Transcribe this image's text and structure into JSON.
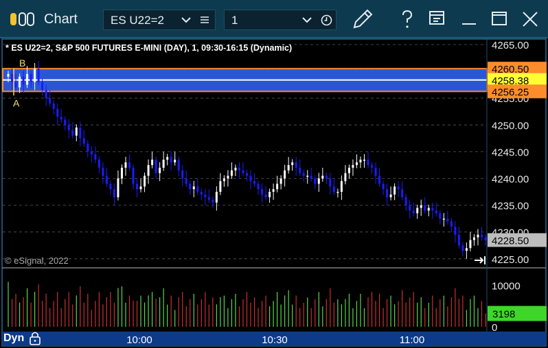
{
  "app": {
    "title": "Chart"
  },
  "toolbar": {
    "symbol": "ES U22=2",
    "interval": "1",
    "icons": [
      "app-logo-icon",
      "chevron-down-icon",
      "list-icon",
      "chevron-down-icon",
      "clock-icon",
      "pencil-icon",
      "help-icon",
      "layout-icon",
      "minimize-icon",
      "maximize-icon",
      "close-icon"
    ]
  },
  "chart_title": "* ES U22=2, S&P 500 FUTURES E-MINI (DAY), 1, 09:30-16:15 (Dynamic)",
  "copyright": "© eSignal, 2022",
  "footer": {
    "mode": "Dyn"
  },
  "colors": {
    "up": "#ffffff",
    "down": "#1b1bff",
    "band": "#2e5de8",
    "band_border": "#ff8c2a",
    "volume_up": "#5bd94d",
    "volume_down": "#cc2f2f",
    "title_bar": "#0e3a4f"
  },
  "chart_data": {
    "type": "candlestick",
    "title": "* ES U22=2, S&P 500 FUTURES E-MINI (DAY), 1, 09:30-16:15 (Dynamic)",
    "price_axis": {
      "ylim": [
        4224,
        4266
      ],
      "ticks": [
        "4265.00",
        "4260.00",
        "4255.00",
        "4250.00",
        "4245.00",
        "4240.00",
        "4235.00",
        "4230.00",
        "4225.00"
      ]
    },
    "price_labels": [
      {
        "value": 4260.5,
        "text": "4260.50",
        "bg": "#ff8c2a",
        "fg": "#000000"
      },
      {
        "value": 4258.38,
        "text": "4258.38",
        "bg": "#ffff33",
        "fg": "#000000"
      },
      {
        "value": 4256.25,
        "text": "4256.25",
        "bg": "#ff8c2a",
        "fg": "#000000"
      },
      {
        "value": 4228.5,
        "text": "4228.50",
        "bg": "#bdbdbd",
        "fg": "#000000"
      }
    ],
    "range_band": {
      "high": 4260.5,
      "mid": 4258.38,
      "low": 4256.25,
      "labels": [
        "B",
        "A"
      ]
    },
    "time_axis": {
      "ticks": [
        "10:00",
        "10:30",
        "11:00"
      ]
    },
    "closes": [
      4259.5,
      4258,
      4257,
      4259,
      4257.5,
      4259.5,
      4258,
      4260.5,
      4258,
      4256.5,
      4255,
      4254,
      4253,
      4251.5,
      4251,
      4250,
      4249,
      4248,
      4249.5,
      4247.5,
      4246.5,
      4245,
      4244.5,
      4243.5,
      4242,
      4240.5,
      4239,
      4238,
      4236.5,
      4240,
      4242,
      4243,
      4242,
      4239,
      4238,
      4238.5,
      4240.5,
      4242.5,
      4243.5,
      4241,
      4242,
      4243.5,
      4244,
      4243,
      4243.5,
      4241.5,
      4240,
      4239,
      4238,
      4238.5,
      4237.5,
      4237,
      4236.5,
      4236,
      4235.5,
      4237.5,
      4239.5,
      4240,
      4240.5,
      4241.5,
      4242,
      4241.5,
      4241,
      4240.5,
      4239.5,
      4239,
      4238,
      4237,
      4236.5,
      4237.5,
      4238,
      4239,
      4240,
      4241.5,
      4242.5,
      4243,
      4242,
      4241,
      4240.5,
      4240.5,
      4240,
      4239,
      4240,
      4240.5,
      4240,
      4238.5,
      4237.5,
      4237.5,
      4239.5,
      4241,
      4242,
      4242.5,
      4243,
      4243.5,
      4243.5,
      4242.5,
      4242,
      4240.5,
      4239,
      4238,
      4236.5,
      4237,
      4238.5,
      4238,
      4236.5,
      4235,
      4234,
      4233.5,
      4234.5,
      4235,
      4234,
      4234.5,
      4234,
      4233.5,
      4232.5,
      4232.5,
      4232,
      4231,
      4229.5,
      4227.5,
      4226.5,
      4227,
      4228.5,
      4229,
      4229.5,
      4229,
      4228.5
    ],
    "volume_axis": {
      "ylim": [
        0,
        14000
      ],
      "ticks": [
        "10000",
        "0"
      ],
      "last": {
        "value": 3198,
        "text": "3198",
        "bg": "#3fd62a",
        "fg": "#000000"
      }
    }
  }
}
